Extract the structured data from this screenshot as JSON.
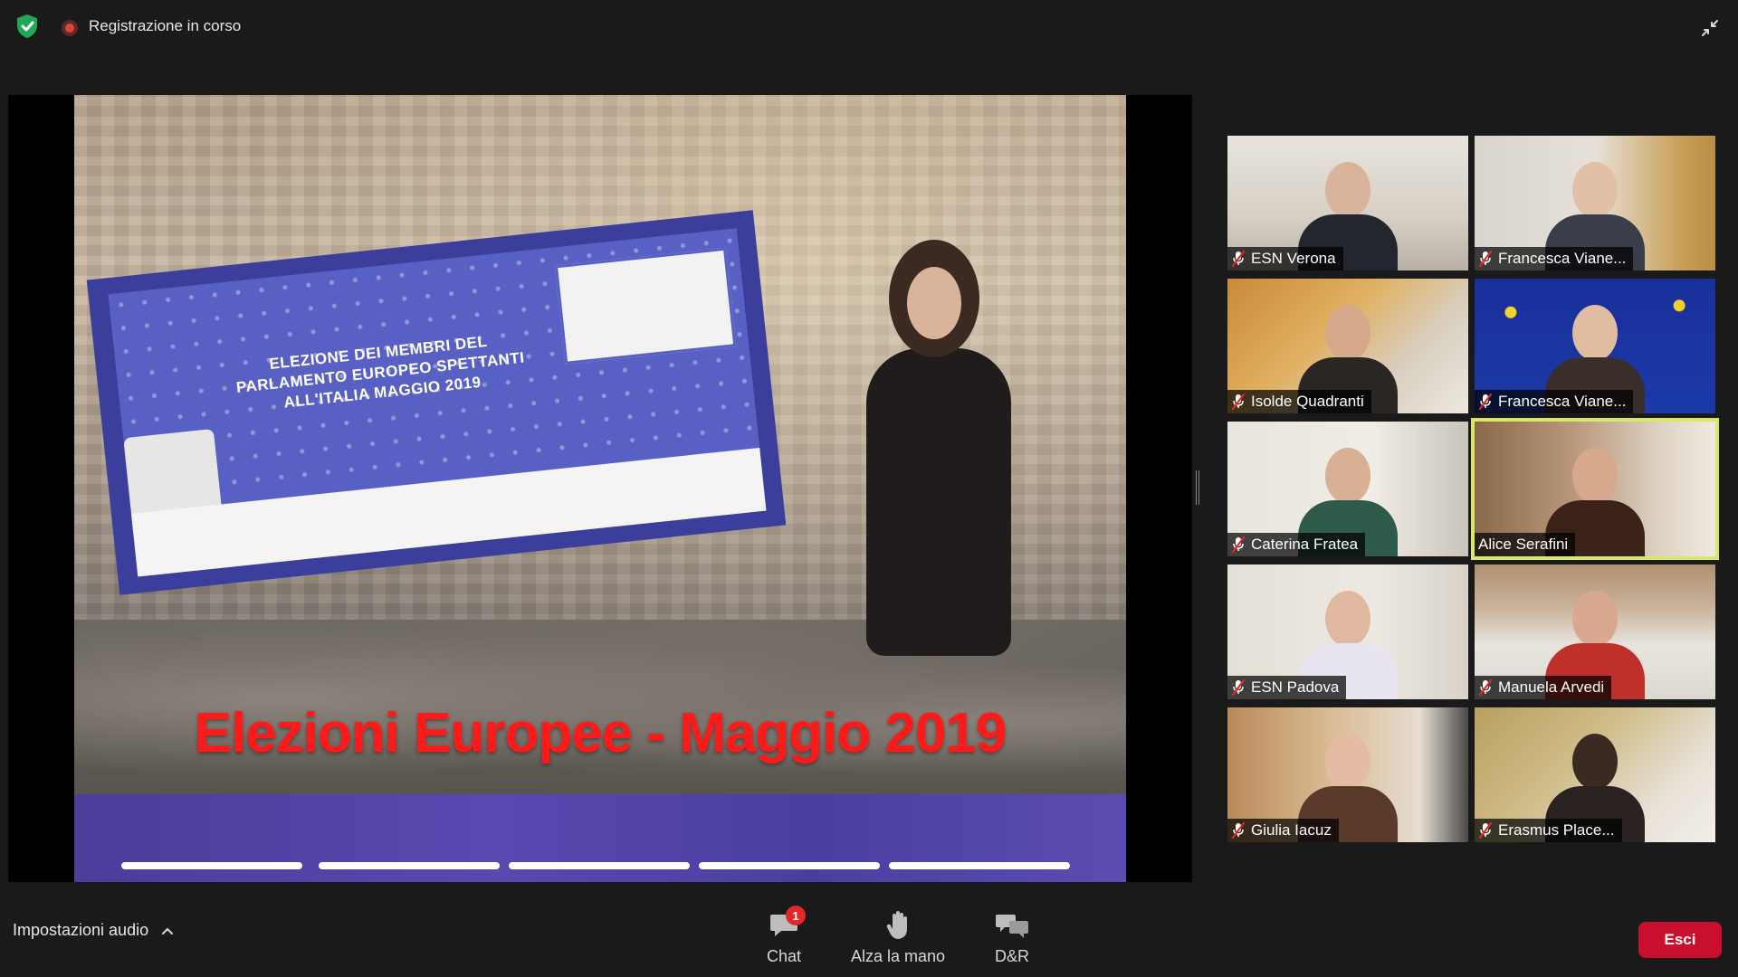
{
  "topbar": {
    "recording_label": "Registrazione in corso"
  },
  "slide": {
    "title": "Elezioni Europee - Maggio 2019",
    "envelope_text": "ELEZIONE DEI MEMBRI DEL PARLAMENTO EUROPEO SPETTANTI ALL'ITALIA MAGGIO 2019",
    "progress_segments": 5,
    "title_color": "#ff1a1a"
  },
  "participants": [
    {
      "name": "ESN Verona",
      "muted": true,
      "active": false
    },
    {
      "name": "Francesca Viane...",
      "muted": true,
      "active": false
    },
    {
      "name": "Isolde Quadranti",
      "muted": true,
      "active": false
    },
    {
      "name": "Francesca Viane...",
      "muted": true,
      "active": false
    },
    {
      "name": "Caterina Fratea",
      "muted": true,
      "active": false
    },
    {
      "name": "Alice Serafini",
      "muted": false,
      "active": true
    },
    {
      "name": "ESN Padova",
      "muted": true,
      "active": false
    },
    {
      "name": "Manuela Arvedi",
      "muted": true,
      "active": false
    },
    {
      "name": "Giulia Iacuz",
      "muted": true,
      "active": false
    },
    {
      "name": "Erasmus  Place...",
      "muted": true,
      "active": false
    }
  ],
  "toolbar": {
    "audio_settings_label": "Impostazioni audio",
    "chat_label": "Chat",
    "chat_badge": "1",
    "raise_hand_label": "Alza la mano",
    "qa_label": "D&R",
    "exit_label": "Esci"
  },
  "colors": {
    "background": "#1a1a1a",
    "exit_button": "#c8102e",
    "active_speaker_border": "#d8e86a",
    "shield": "#1fa855",
    "recording": "#e0453a"
  }
}
